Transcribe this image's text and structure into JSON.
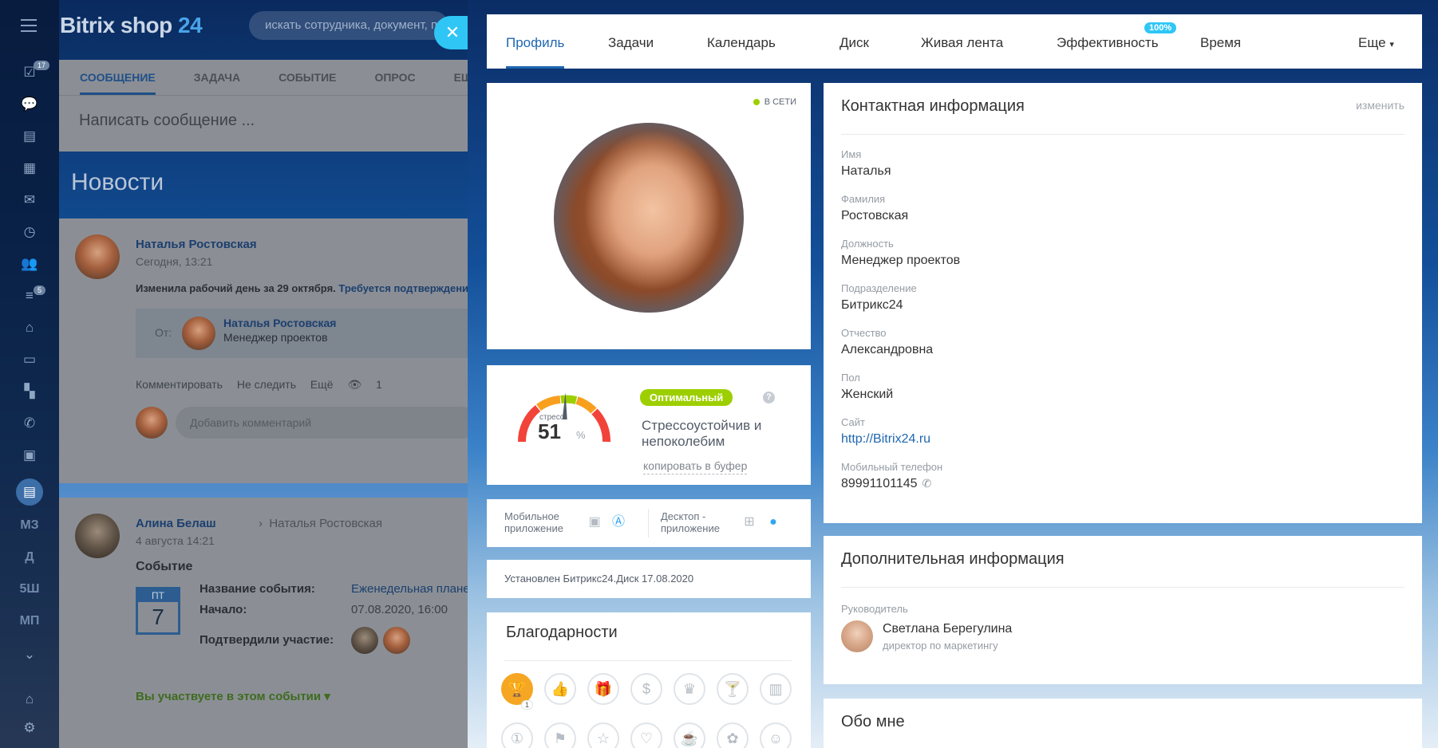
{
  "background": {
    "logo": "Bitrix shop",
    "logo_num": "24",
    "search_placeholder": "искать сотрудника, документ, прочее...",
    "rail": {
      "tasks_badge": "17",
      "filter_badge": "5",
      "text_items": [
        "МЗ",
        "Д",
        "5Ш",
        "МП"
      ]
    },
    "composer": {
      "tabs": [
        "СООБЩЕНИЕ",
        "ЗАДАЧА",
        "СОБЫТИЕ",
        "ОПРОС",
        "ЕЩЁ"
      ],
      "placeholder": "Написать сообщение ..."
    },
    "news_title": "Новости",
    "post1": {
      "author": "Наталья Ростовская",
      "date": "Сегодня, 13:21",
      "text": "Изменила рабочий день за 29 октября.",
      "text_link": "Требуется подтверждение",
      "from_label": "От:",
      "from_name": "Наталья Ростовская",
      "from_position": "Менеджер проектов",
      "actions": [
        "Комментировать",
        "Не следить",
        "Ещё"
      ],
      "views": "1",
      "comment_placeholder": "Добавить комментарий"
    },
    "post2": {
      "author": "Алина Белаш",
      "recipient": "Наталья Ростовская",
      "date": "4 августа 14:21",
      "title": "Событие",
      "cal_dow": "ПТ",
      "cal_day": "7",
      "name_label": "Название события:",
      "name_value": "Еженедельная планерка",
      "start_label": "Начало:",
      "start_value": "07.08.2020, 16:00",
      "confirmed_label": "Подтвердили участие:",
      "participate": "Вы участвуете в этом событии"
    }
  },
  "nav": {
    "items": [
      "Профиль",
      "Задачи",
      "Календарь",
      "Диск",
      "Живая лента",
      "Эффективность",
      "Время",
      "Еще"
    ],
    "efficiency_badge": "100%"
  },
  "profile": {
    "online": "В СЕТИ",
    "stress": {
      "label": "стресс",
      "value": "51",
      "unit": "%",
      "level": 0.51,
      "status": "Оптимальный",
      "help": "?",
      "description": "Стрессоустойчив и непоколебим",
      "copy": "копировать в буфер"
    },
    "apps": {
      "mobile": "Мобильное приложение",
      "desktop": "Десктоп - приложение"
    },
    "disk_info": "Установлен Битрикс24.Диск 17.08.2020",
    "thanks_title": "Благодарности",
    "thanks_count": "1"
  },
  "contact": {
    "title": "Контактная информация",
    "edit": "изменить",
    "fields": [
      {
        "label": "Имя",
        "value": "Наталья"
      },
      {
        "label": "Фамилия",
        "value": "Ростовская"
      },
      {
        "label": "Должность",
        "value": "Менеджер проектов"
      },
      {
        "label": "Подразделение",
        "value": "Битрикс24"
      },
      {
        "label": "Отчество",
        "value": "Александровна"
      },
      {
        "label": "Пол",
        "value": "Женский"
      },
      {
        "label": "Сайт",
        "value": "http://Bitrix24.ru"
      },
      {
        "label": "Мобильный телефон",
        "value": "89991101145"
      }
    ]
  },
  "extra": {
    "title": "Дополнительная информация",
    "manager_label": "Руководитель",
    "manager_name": "Светлана Берегулина",
    "manager_position": "директор по маркетингу"
  },
  "about": {
    "title": "Обо мне"
  },
  "colors": {
    "accent": "#2067b0",
    "online": "#9dcf00",
    "efficiency_badge": "#2fc6f6",
    "close_button": "#2fc6f6",
    "thanks_gold": "#f5a623"
  }
}
